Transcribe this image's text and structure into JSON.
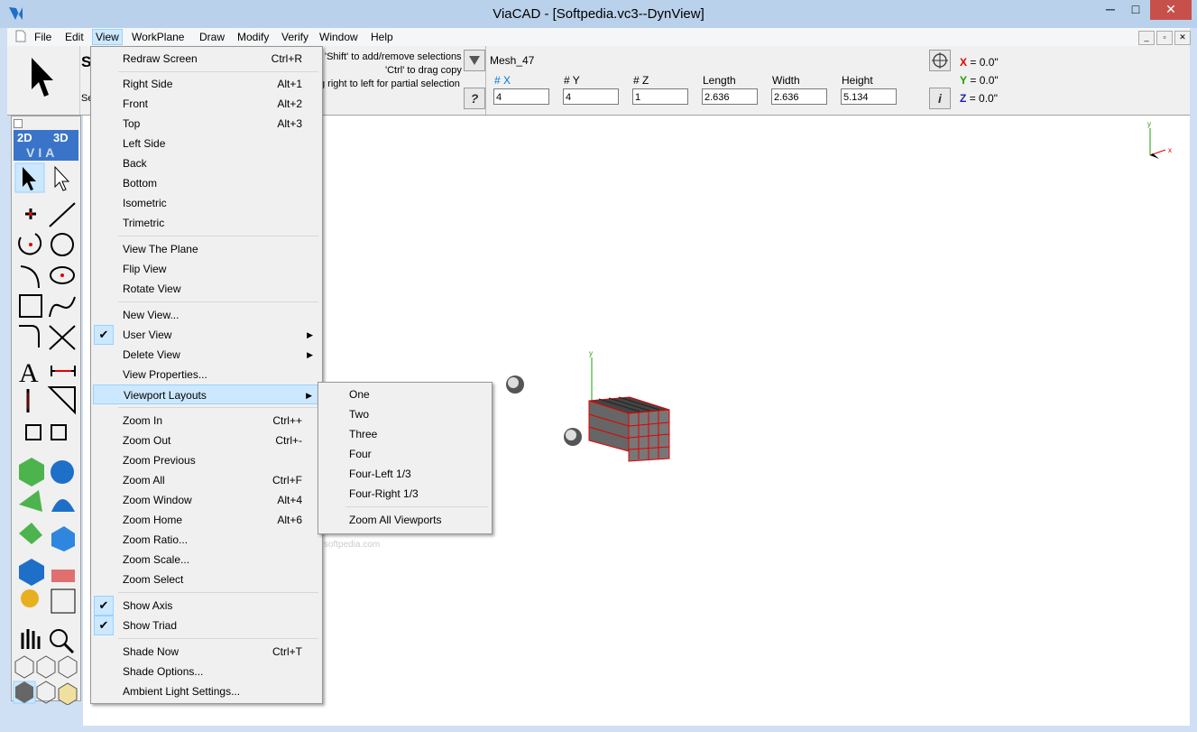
{
  "window": {
    "title": "ViaCAD - [Softpedia.vc3--DynView]",
    "minimize": "─",
    "maximize": "□",
    "close": "✕"
  },
  "menubar": {
    "items": [
      "File",
      "Edit",
      "View",
      "WorkPlane",
      "Draw",
      "Modify",
      "Verify",
      "Window",
      "Help"
    ],
    "active": "View",
    "mdi_buttons": [
      "_",
      "▫",
      "✕"
    ]
  },
  "toolbar": {
    "select_letter": "S",
    "select_sub": "Se",
    "hints": [
      "'Shift' to add/remove selections",
      "'Ctrl' to drag copy",
      "g right to left for partial selection"
    ],
    "help_button": "?",
    "info_button": "i",
    "object_name": "Mesh_47",
    "fields": [
      {
        "label": "# X",
        "value": "4",
        "blue": true
      },
      {
        "label": "# Y",
        "value": "4",
        "blue": false
      },
      {
        "label": "# Z",
        "value": "1",
        "blue": false
      },
      {
        "label": "Length",
        "value": "2.636",
        "blue": false
      },
      {
        "label": "Width",
        "value": "2.636",
        "blue": false
      },
      {
        "label": "Height",
        "value": "5.134",
        "blue": false
      }
    ],
    "coords": [
      {
        "axis": "X",
        "value": "= 0.0\"",
        "color": "#e00000"
      },
      {
        "axis": "Y",
        "value": "= 0.0\"",
        "color": "#1aa000"
      },
      {
        "axis": "Z",
        "value": "= 0.0\"",
        "color": "#1a1acc"
      }
    ]
  },
  "palette": {
    "header_2d": "2D",
    "header_3d": "3D",
    "header_via": "VIA"
  },
  "view_menu": {
    "items": [
      {
        "label": "Redraw Screen",
        "shortcut": "Ctrl+R"
      },
      {
        "label": "Right Side",
        "shortcut": "Alt+1"
      },
      {
        "label": "Front",
        "shortcut": "Alt+2"
      },
      {
        "label": "Top",
        "shortcut": "Alt+3"
      },
      {
        "label": "Left Side",
        "shortcut": ""
      },
      {
        "label": "Back",
        "shortcut": ""
      },
      {
        "label": "Bottom",
        "shortcut": ""
      },
      {
        "label": "Isometric",
        "shortcut": ""
      },
      {
        "label": "Trimetric",
        "shortcut": ""
      },
      {
        "label": "View The Plane",
        "shortcut": ""
      },
      {
        "label": "Flip View",
        "shortcut": ""
      },
      {
        "label": "Rotate View",
        "shortcut": ""
      },
      {
        "label": "New View...",
        "shortcut": ""
      },
      {
        "label": "User View",
        "shortcut": "",
        "submenu": true,
        "checked": true
      },
      {
        "label": "Delete View",
        "shortcut": "",
        "submenu": true
      },
      {
        "label": "View Properties...",
        "shortcut": ""
      },
      {
        "label": "Viewport Layouts",
        "shortcut": "",
        "submenu": true,
        "highlighted": true
      },
      {
        "label": "Zoom In",
        "shortcut": "Ctrl++"
      },
      {
        "label": "Zoom Out",
        "shortcut": "Ctrl+-"
      },
      {
        "label": "Zoom Previous",
        "shortcut": ""
      },
      {
        "label": "Zoom All",
        "shortcut": "Ctrl+F"
      },
      {
        "label": "Zoom Window",
        "shortcut": "Alt+4"
      },
      {
        "label": "Zoom Home",
        "shortcut": "Alt+6"
      },
      {
        "label": "Zoom Ratio...",
        "shortcut": ""
      },
      {
        "label": "Zoom Scale...",
        "shortcut": ""
      },
      {
        "label": "Zoom Select",
        "shortcut": ""
      },
      {
        "label": "Show Axis",
        "shortcut": "",
        "checked": true
      },
      {
        "label": "Show Triad",
        "shortcut": "",
        "checked": true
      },
      {
        "label": "Shade Now",
        "shortcut": "Ctrl+T"
      },
      {
        "label": "Shade Options...",
        "shortcut": ""
      },
      {
        "label": "Ambient Light Settings...",
        "shortcut": ""
      }
    ],
    "check_glyph": "✔",
    "submenu_glyph": "▶"
  },
  "viewport_submenu": {
    "items": [
      "One",
      "Two",
      "Three",
      "Four",
      "Four-Left 1/3",
      "Four-Right 1/3",
      "Zoom All Viewports"
    ]
  },
  "canvas": {
    "triad_y": "y",
    "triad_x": "x",
    "axis_label": "y",
    "watermark": "SOFTPEDIA",
    "watermark_url": "www.softpedia.com"
  },
  "colors": {
    "accent": "#0078d7",
    "menu_highlight": "#cce8ff",
    "mesh_edge": "#e00000"
  }
}
